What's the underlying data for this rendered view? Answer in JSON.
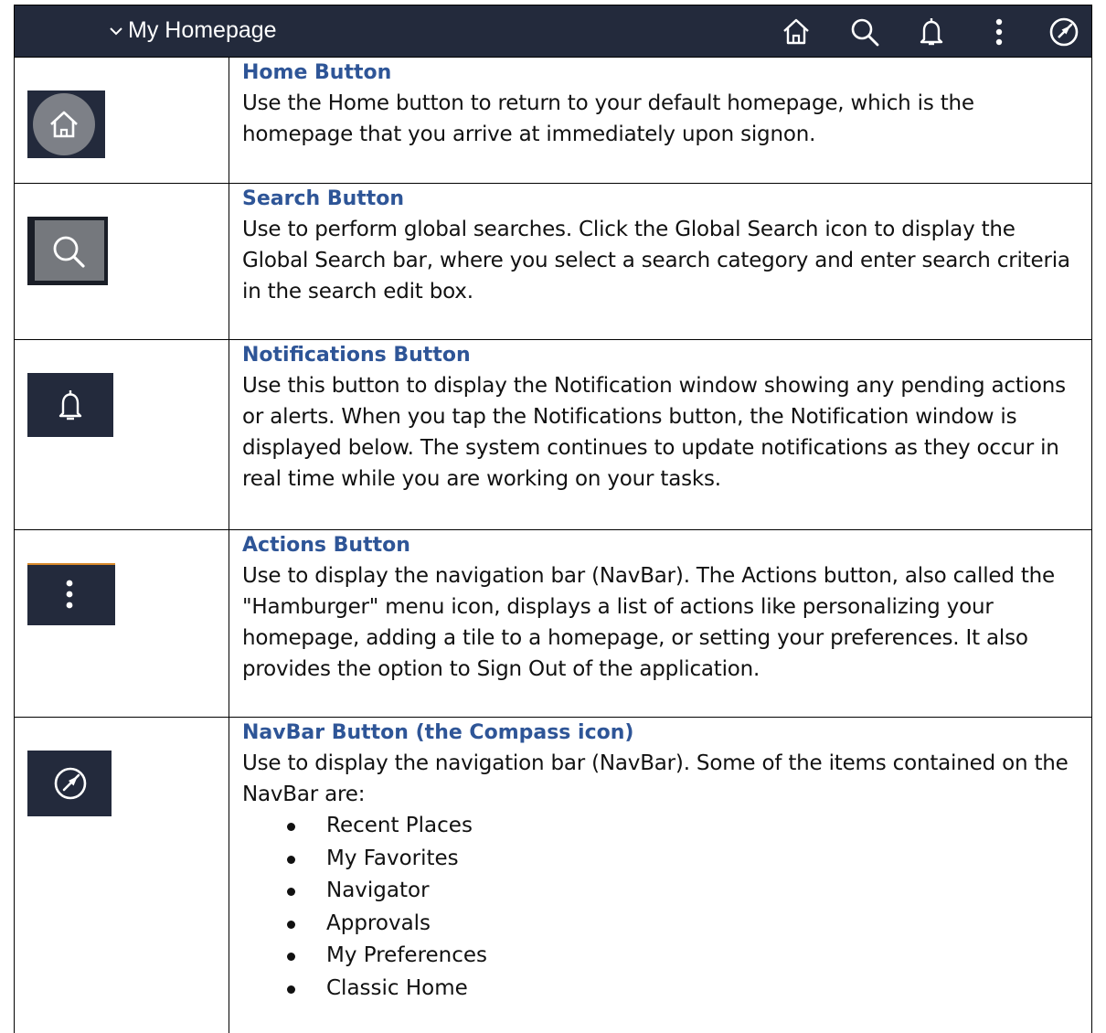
{
  "navbar": {
    "title": "My Homepage",
    "icons": [
      "home-icon",
      "search-icon",
      "bell-icon",
      "more-vertical-icon",
      "compass-icon"
    ],
    "background": "#232a3c"
  },
  "rows": [
    {
      "icon": "home-icon",
      "heading": "Home Button",
      "body": "Use the Home button to return to your default homepage, which is the homepage that you arrive at immediately upon signon."
    },
    {
      "icon": "search-icon",
      "heading": "Search Button",
      "body": "Use to perform global searches. Click the Global Search icon to display the Global Search bar, where you select a search category and enter search criteria in the search edit box."
    },
    {
      "icon": "bell-icon",
      "heading": "Notifications Button",
      "body": "Use this button to display the Notification window showing any pending actions or alerts. When you tap the Notifications button, the Notification window is displayed below. The system continues to update notifications as they occur in real time while you are working on your tasks."
    },
    {
      "icon": "more-vertical-icon",
      "heading": "Actions Button",
      "body": "Use to display the navigation bar (NavBar). The Actions button, also called the \"Hamburger\" menu icon, displays a list of actions like personalizing your homepage, adding a tile to a homepage, or setting your preferences. It also provides the option to Sign Out of the application."
    },
    {
      "icon": "compass-icon",
      "heading": "NavBar Button (the Compass icon)",
      "body": "Use to display the navigation bar (NavBar). Some of the items contained on the NavBar are:",
      "bullets": [
        "Recent Places",
        "My Favorites",
        "Navigator",
        "Approvals",
        "My Preferences",
        "Classic Home"
      ]
    }
  ],
  "colors": {
    "heading": "#2e5597",
    "icon_background": "#232a3c",
    "text": "#111111"
  }
}
